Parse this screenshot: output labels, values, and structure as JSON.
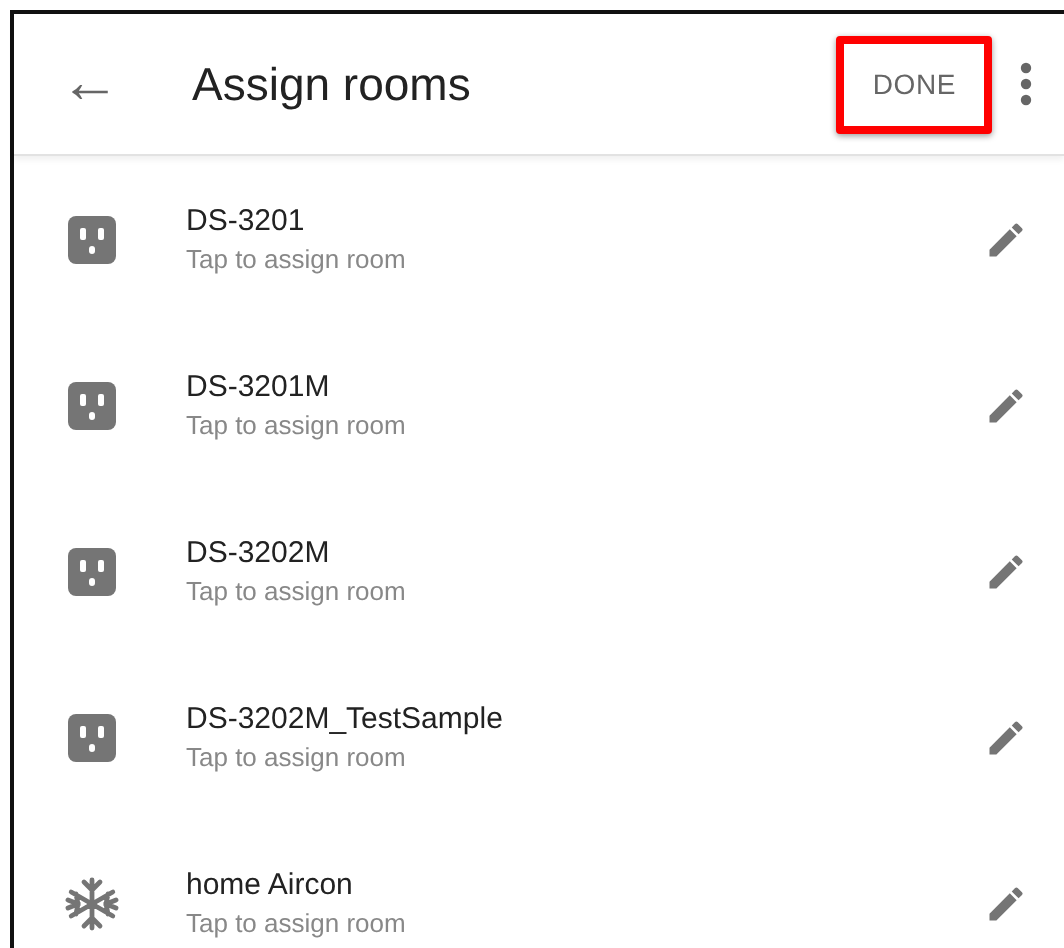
{
  "app_bar": {
    "back_icon": "←",
    "title": "Assign rooms",
    "done_button": {
      "label": "DONE",
      "highlighted": true
    }
  },
  "devices": [
    {
      "kind": "outlet",
      "name": "DS-3201",
      "subtitle": "Tap to assign room"
    },
    {
      "kind": "outlet",
      "name": "DS-3201M",
      "subtitle": "Tap to assign room"
    },
    {
      "kind": "outlet",
      "name": "DS-3202M",
      "subtitle": "Tap to assign room"
    },
    {
      "kind": "outlet",
      "name": "DS-3202M_TestSample",
      "subtitle": "Tap to assign room"
    },
    {
      "kind": "aircon",
      "name": "home Aircon",
      "subtitle": "Tap to assign room"
    }
  ]
}
